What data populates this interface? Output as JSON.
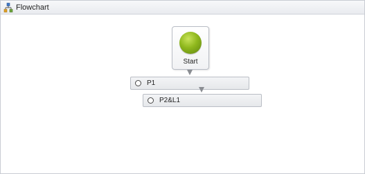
{
  "header": {
    "title": "Flowchart",
    "icon": "flowchart-icon"
  },
  "canvas": {
    "start_node": {
      "label": "Start",
      "color": "#8fb81d"
    },
    "activities": [
      {
        "label": "P1",
        "icon": "circle-icon"
      },
      {
        "label": "P2&L1",
        "icon": "circle-icon"
      }
    ],
    "connector_color": "#8a8d92"
  }
}
